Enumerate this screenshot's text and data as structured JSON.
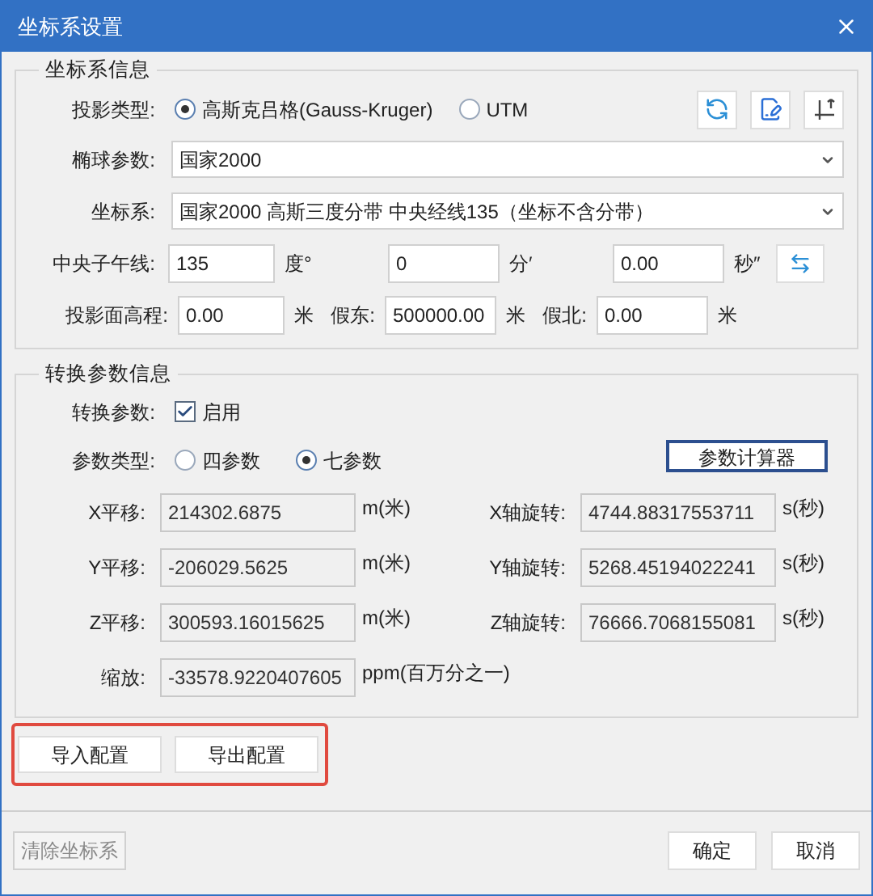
{
  "window": {
    "title": "坐标系设置"
  },
  "coordinate_group": {
    "title": "坐标系信息",
    "projection_type": {
      "label": "投影类型:",
      "options": [
        {
          "label": "高斯克吕格(Gauss-Kruger)",
          "selected": true
        },
        {
          "label": "UTM",
          "selected": false
        }
      ]
    },
    "ellipsoid": {
      "label": "椭球参数:",
      "value": "国家2000"
    },
    "coordinate_system": {
      "label": "坐标系:",
      "value": "国家2000 高斯三度分带 中央经线135（坐标不含分带）"
    },
    "central_meridian": {
      "label": "中央子午线:",
      "fields": [
        {
          "value": "135",
          "unit": "度°"
        },
        {
          "value": "0",
          "unit": "分′"
        },
        {
          "value": "0.00",
          "unit": "秒″"
        }
      ]
    },
    "projection_height": {
      "fields": [
        {
          "label": "投影面高程:",
          "value": "0.00",
          "unit": "米"
        },
        {
          "label": "假东:",
          "value": "500000.00",
          "unit": "米"
        },
        {
          "label": "假北:",
          "value": "0.00",
          "unit": "米"
        }
      ]
    }
  },
  "transform_group": {
    "title": "转换参数信息",
    "enable": {
      "label": "转换参数:",
      "checkbox_label": "启用",
      "checked": true
    },
    "parameter_type": {
      "label": "参数类型:",
      "options": [
        {
          "label": "四参数",
          "selected": false
        },
        {
          "label": "七参数",
          "selected": true
        }
      ]
    },
    "calculator_button": "参数计算器",
    "rows": [
      {
        "left": {
          "label": "X平移:",
          "value": "214302.6875",
          "unit": "m(米)"
        },
        "right": {
          "label": "X轴旋转:",
          "value": "4744.88317553711",
          "unit": "s(秒)"
        }
      },
      {
        "left": {
          "label": "Y平移:",
          "value": "-206029.5625",
          "unit": "m(米)"
        },
        "right": {
          "label": "Y轴旋转:",
          "value": "5268.45194022241",
          "unit": "s(秒)"
        }
      },
      {
        "left": {
          "label": "Z平移:",
          "value": "300593.16015625",
          "unit": "m(米)"
        },
        "right": {
          "label": "Z轴旋转:",
          "value": "76666.7068155081",
          "unit": "s(秒)"
        }
      },
      {
        "left": {
          "label": "缩放:",
          "value": "-33578.9220407605",
          "unit": "ppm(百万分之一)"
        }
      }
    ]
  },
  "config_buttons": [
    "导入配置",
    "导出配置"
  ],
  "footer": {
    "clear_button": {
      "label": "清除坐标系",
      "disabled": true
    },
    "buttons": [
      "确定",
      "取消"
    ]
  }
}
